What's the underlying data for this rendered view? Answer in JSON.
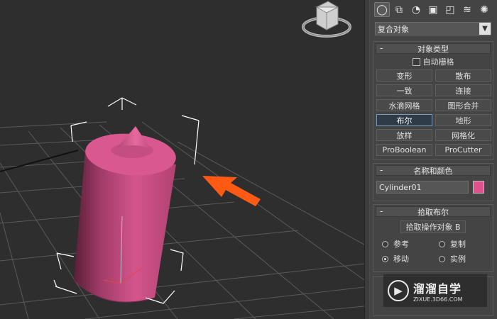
{
  "toolbar_tabs": [
    {
      "icon": "geometry-icon",
      "glyph": "◯",
      "active": true
    },
    {
      "icon": "shapes-icon",
      "glyph": "⧉",
      "active": false
    },
    {
      "icon": "lights-icon",
      "glyph": "◔",
      "active": false
    },
    {
      "icon": "cameras-icon",
      "glyph": "▣",
      "active": false
    },
    {
      "icon": "helpers-icon",
      "glyph": "◰",
      "active": false
    },
    {
      "icon": "spacewarps-icon",
      "glyph": "≋",
      "active": false
    },
    {
      "icon": "systems-icon",
      "glyph": "✺",
      "active": false
    }
  ],
  "category_dropdown": {
    "value": "复合对象"
  },
  "object_type": {
    "title": "对象类型",
    "autogrid_label": "自动栅格",
    "buttons": [
      {
        "label": "变形",
        "active": false
      },
      {
        "label": "散布",
        "active": false
      },
      {
        "label": "一致",
        "active": false
      },
      {
        "label": "连接",
        "active": false
      },
      {
        "label": "水滴网格",
        "active": false
      },
      {
        "label": "图形合并",
        "active": false
      },
      {
        "label": "布尔",
        "active": true
      },
      {
        "label": "地形",
        "active": false
      },
      {
        "label": "放样",
        "active": false
      },
      {
        "label": "网格化",
        "active": false
      },
      {
        "label": "ProBoolean",
        "active": false
      },
      {
        "label": "ProCutter",
        "active": false
      }
    ]
  },
  "name_color": {
    "title": "名称和颜色",
    "name_value": "Cylinder01",
    "color": "#e0508c"
  },
  "pick_boolean": {
    "title": "拾取布尔",
    "pick_button": "拾取操作对象 B",
    "options": [
      {
        "label": "参考",
        "checked": false
      },
      {
        "label": "复制",
        "checked": false
      },
      {
        "label": "移动",
        "checked": true
      },
      {
        "label": "实例",
        "checked": false
      }
    ]
  },
  "watermark": {
    "title": "溜溜自学",
    "url": "ZIXUE.3D66.COM"
  },
  "colors": {
    "object_pink": "#d84c86",
    "arrow_orange": "#ff5a14",
    "viewport_bg": "#2e2e2e"
  }
}
